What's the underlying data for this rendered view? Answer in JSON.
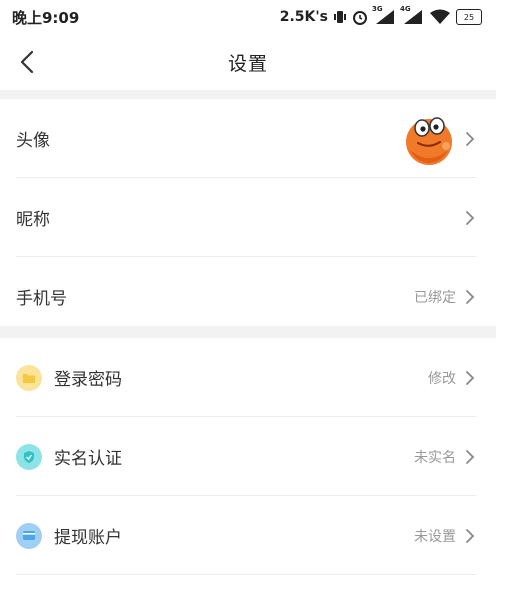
{
  "status_bar": {
    "time": "晚上9:09",
    "speed": "2.5K's",
    "net3g": "3G",
    "net4g": "4G",
    "battery": "25"
  },
  "nav": {
    "title": "设置"
  },
  "profile": {
    "avatar_label": "头像",
    "nickname_label": "昵称",
    "phone_label": "手机号",
    "phone_value": "已绑定"
  },
  "account": {
    "items": [
      {
        "label": "登录密码",
        "value": "修改",
        "icon": "folder-icon",
        "color": "#fbe49a"
      },
      {
        "label": "实名认证",
        "value": "未实名",
        "icon": "shield-check-icon",
        "color": "#8de3e6"
      },
      {
        "label": "提现账户",
        "value": "未设置",
        "icon": "card-icon",
        "color": "#9fd0f3"
      }
    ]
  }
}
